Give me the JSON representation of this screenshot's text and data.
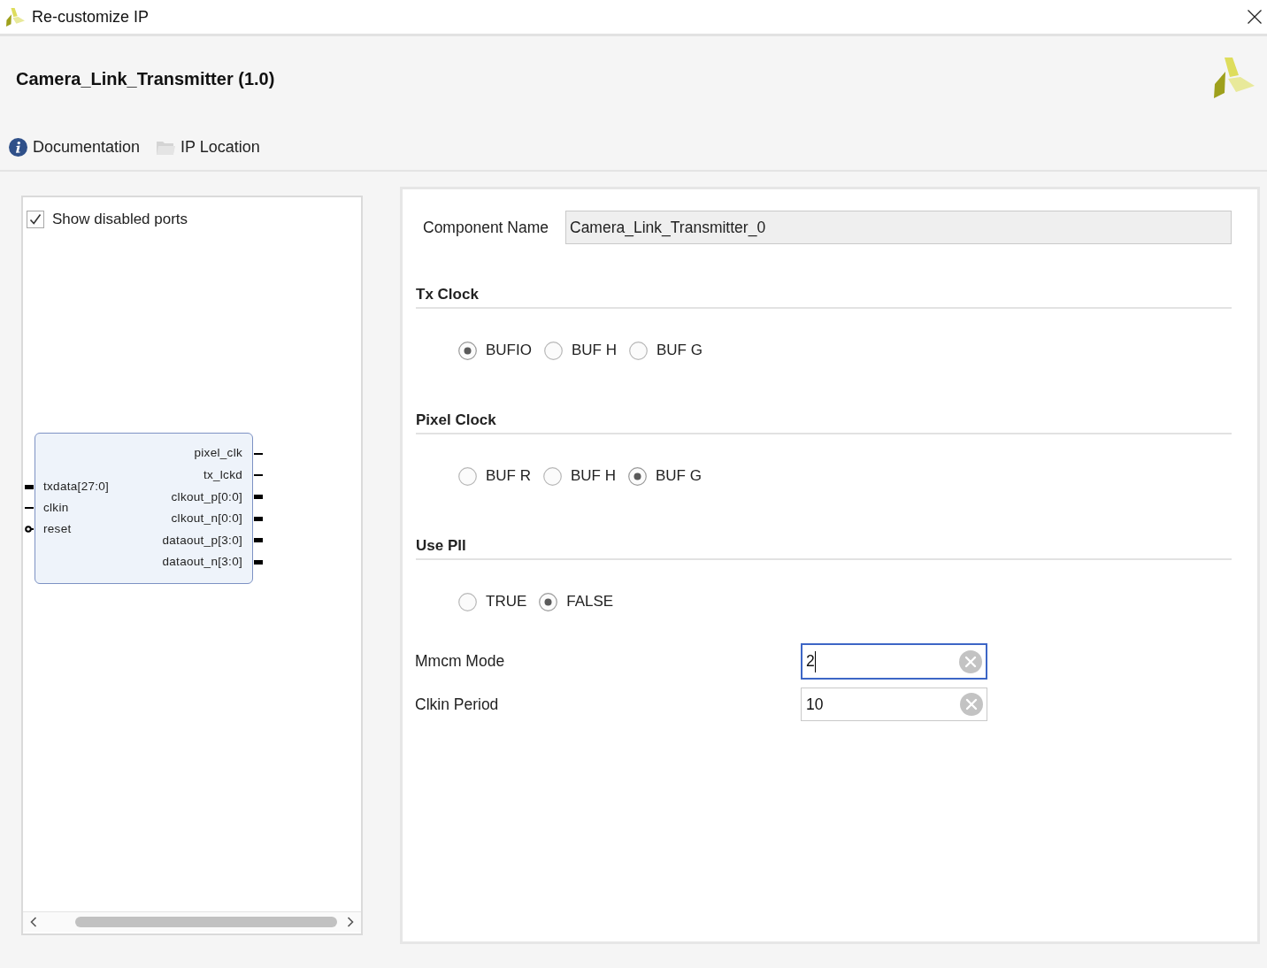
{
  "window": {
    "title": "Re-customize IP"
  },
  "header": {
    "ip_title": "Camera_Link_Transmitter (1.0)",
    "links": [
      {
        "kind": "documentation",
        "label": "Documentation"
      },
      {
        "kind": "location",
        "label": "IP Location"
      }
    ]
  },
  "symbol_panel": {
    "show_disabled_ports": {
      "label": "Show disabled ports",
      "checked": true
    },
    "inputs": [
      {
        "name": "txdata[27:0]",
        "kind": "bus"
      },
      {
        "name": "clkin",
        "kind": "wire"
      },
      {
        "name": "reset",
        "kind": "inverted"
      }
    ],
    "outputs": [
      {
        "name": "pixel_clk",
        "kind": "wire"
      },
      {
        "name": "tx_lckd",
        "kind": "wire"
      },
      {
        "name": "clkout_p[0:0]",
        "kind": "bus"
      },
      {
        "name": "clkout_n[0:0]",
        "kind": "bus"
      },
      {
        "name": "dataout_p[3:0]",
        "kind": "bus"
      },
      {
        "name": "dataout_n[3:0]",
        "kind": "bus"
      }
    ]
  },
  "config": {
    "component_name": {
      "label": "Component Name",
      "value": "Camera_Link_Transmitter_0",
      "read_only": true
    },
    "groups": [
      {
        "title": "Tx Clock",
        "options": [
          {
            "label": "BUFIO",
            "selected": true
          },
          {
            "label": "BUF H",
            "selected": false
          },
          {
            "label": "BUF G",
            "selected": false
          }
        ]
      },
      {
        "title": "Pixel Clock",
        "options": [
          {
            "label": "BUF R",
            "selected": false
          },
          {
            "label": "BUF H",
            "selected": false
          },
          {
            "label": "BUF G",
            "selected": true
          }
        ]
      },
      {
        "title": "Use Pll",
        "options": [
          {
            "label": "TRUE",
            "selected": false
          },
          {
            "label": "FALSE",
            "selected": true
          }
        ]
      }
    ],
    "fields": [
      {
        "label": "Mmcm Mode",
        "value": "2",
        "focused": true
      },
      {
        "label": "Clkin Period",
        "value": "10",
        "focused": false
      }
    ]
  }
}
